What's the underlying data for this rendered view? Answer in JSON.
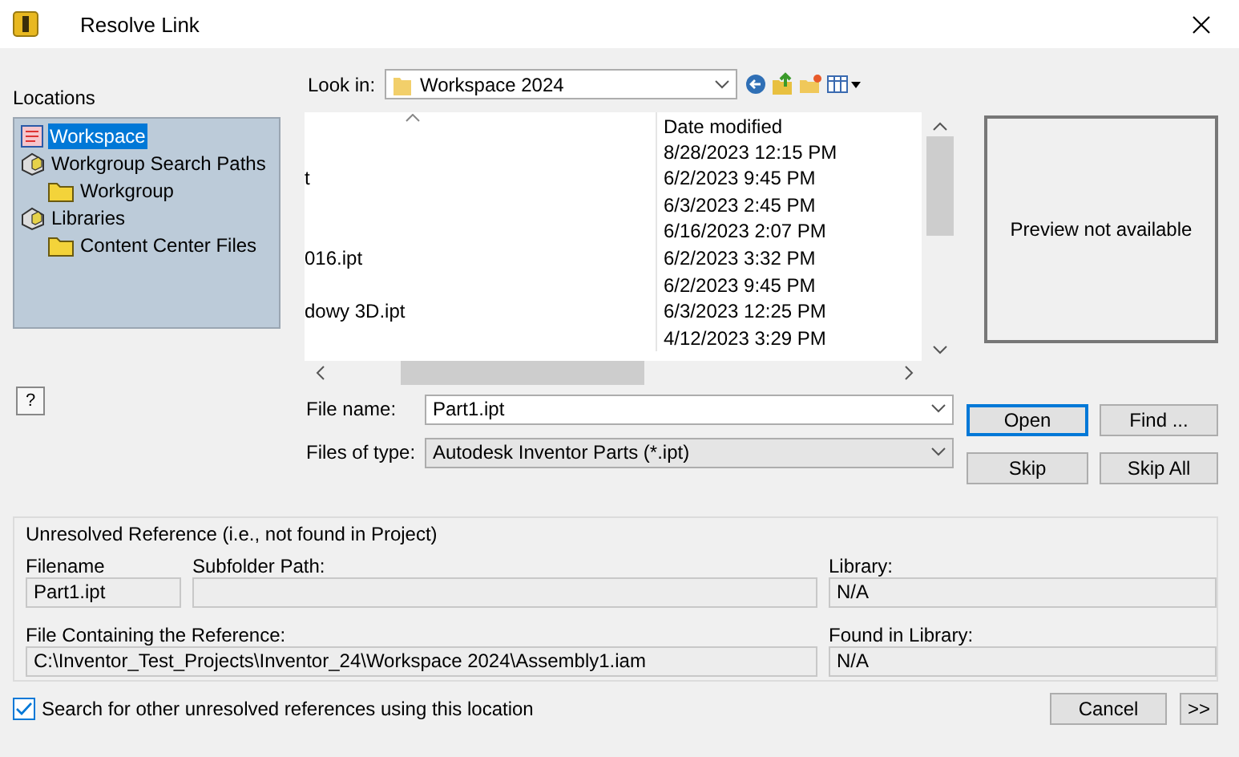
{
  "window": {
    "title": "Resolve Link"
  },
  "locations": {
    "label": "Locations",
    "items": [
      {
        "label": "Workspace",
        "kind": "workspace",
        "selected": true
      },
      {
        "label": "Workgroup Search Paths",
        "kind": "paths",
        "selected": false,
        "children": [
          {
            "label": "Workgroup",
            "kind": "folder",
            "selected": false
          }
        ]
      },
      {
        "label": "Libraries",
        "kind": "paths",
        "selected": false,
        "children": [
          {
            "label": "Content Center Files",
            "kind": "folder",
            "selected": false
          }
        ]
      }
    ]
  },
  "help_button": {
    "label": "?"
  },
  "look_in": {
    "label": "Look in:",
    "value": "Workspace 2024"
  },
  "file_list": {
    "date_header": "Date modified",
    "rows": [
      {
        "date": "8/28/2023 12:15 PM"
      },
      {
        "name": "t",
        "date": "6/2/2023 9:45 PM"
      },
      {
        "date": "6/3/2023 2:45 PM"
      },
      {
        "date": "6/16/2023 2:07 PM"
      },
      {
        "name": "016.ipt",
        "date": "6/2/2023 3:32 PM"
      },
      {
        "date": "6/2/2023 9:45 PM"
      },
      {
        "name": "dowy 3D.ipt",
        "date": "6/3/2023 12:25 PM"
      },
      {
        "date": "4/12/2023 3:29 PM"
      }
    ]
  },
  "preview": {
    "text": "Preview not available"
  },
  "file_name": {
    "label": "File name:",
    "value": "Part1.ipt"
  },
  "files_of_type": {
    "label": "Files of type:",
    "value": "Autodesk Inventor Parts (*.ipt)"
  },
  "buttons": [
    {
      "label": "Open",
      "default": true
    },
    {
      "label": "Find ...",
      "default": false
    },
    {
      "label": "Skip",
      "default": false
    },
    {
      "label": "Skip All",
      "default": false
    }
  ],
  "unresolved": {
    "title": "Unresolved Reference (i.e., not found in Project)",
    "filename": {
      "label": "Filename",
      "value": "Part1.ipt"
    },
    "subfolder": {
      "label": "Subfolder Path:"
    },
    "library": {
      "label": "Library:",
      "value": "N/A"
    },
    "containing_file": {
      "label": "File Containing the Reference:",
      "value": "C:\\Inventor_Test_Projects\\Inventor_24\\Workspace 2024\\Assembly1.iam"
    },
    "found_in_library": {
      "label": "Found in Library:",
      "value": "N/A"
    }
  },
  "search_option": {
    "label": "Search for other unresolved references using this location",
    "checked": true
  },
  "footer_buttons": [
    {
      "label": "Cancel"
    },
    {
      "label": ">>"
    }
  ]
}
